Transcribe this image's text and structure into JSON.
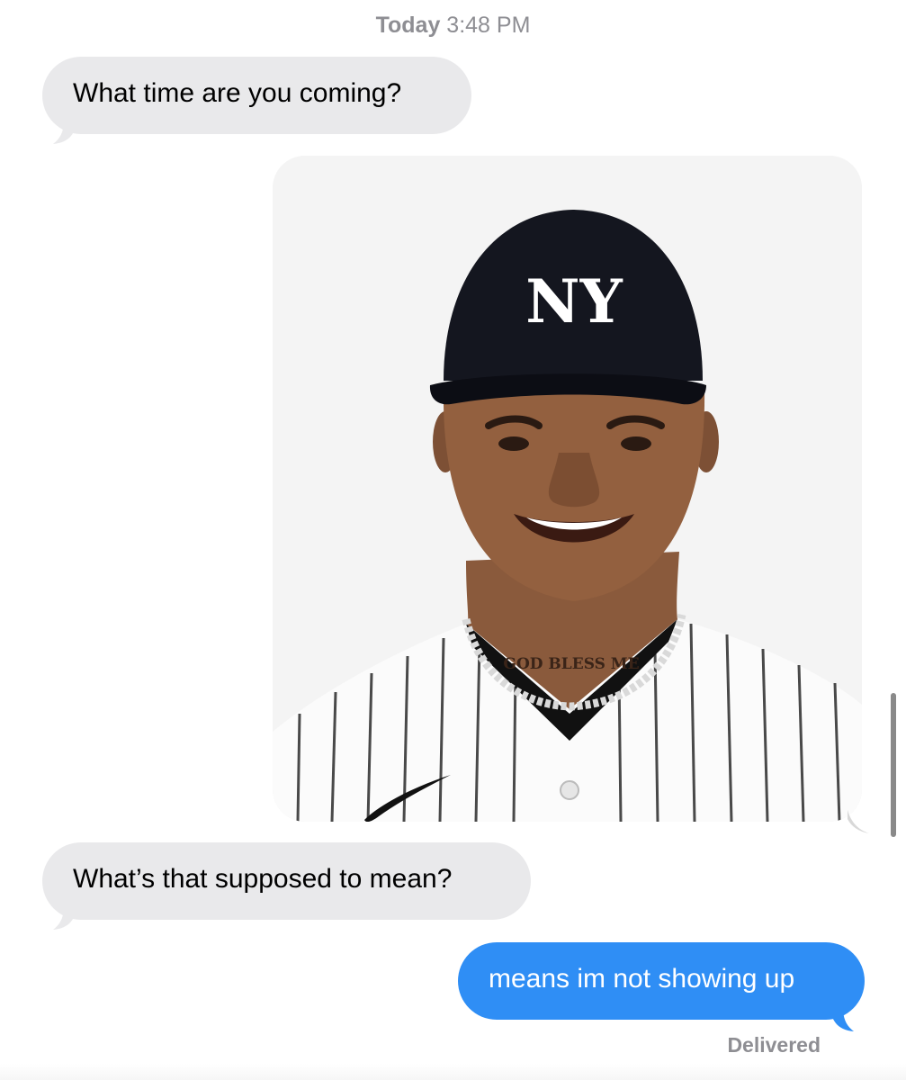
{
  "thread": {
    "timestamp_day": "Today",
    "timestamp_time": "3:48 PM",
    "messages": [
      {
        "direction": "incoming",
        "type": "text",
        "text": "What time are you coming?"
      },
      {
        "direction": "outgoing",
        "type": "image",
        "image_text": {
          "cap_logo": "NY",
          "tattoo": "GOD BLESS ME"
        }
      },
      {
        "direction": "incoming",
        "type": "text",
        "text": "What’s that supposed to mean?"
      },
      {
        "direction": "outgoing",
        "type": "text",
        "text": "means im not showing up"
      }
    ],
    "delivery_status": "Delivered"
  },
  "colors": {
    "incoming_bubble": "#e9e9eb",
    "outgoing_bubble": "#2f8ef5",
    "meta_text": "#8e8e93",
    "photo_background": "#f4f4f4"
  },
  "icons": {
    "jersey_logo": "swoosh-icon",
    "cap_logo": "ny-logo-icon"
  }
}
